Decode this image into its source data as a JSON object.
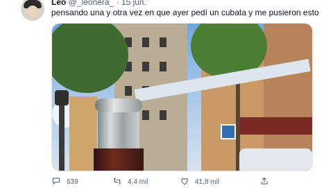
{
  "tweet": {
    "author_name": "Leo",
    "handle_date": "@_leonera_ · 15 jun.",
    "text": "pensando una y otra vez en que ayer pedí un cubata y me pusieron esto"
  },
  "actions": {
    "reply_count": "639",
    "retweet_count": "4,4 mil",
    "like_count": "41,8 mil"
  },
  "icons": [
    "reply-icon",
    "retweet-icon",
    "like-icon",
    "share-icon"
  ]
}
